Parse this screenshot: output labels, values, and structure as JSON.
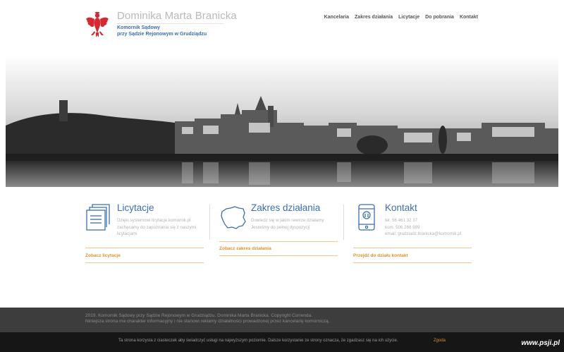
{
  "header": {
    "title": "Dominika Marta Branicka",
    "subtitle_line1": "Komornik Sądowy",
    "subtitle_line2": "przy Sądzie Rejonowym w Grudziądzu",
    "logo_icon": "eagle-icon",
    "nav": [
      {
        "label": "Kancelaria"
      },
      {
        "label": "Zakres działania"
      },
      {
        "label": "Licytacje"
      },
      {
        "label": "Do pobrania"
      },
      {
        "label": "Kontakt"
      }
    ]
  },
  "columns": [
    {
      "title": "Licytacje",
      "icon": "documents-icon",
      "text": [
        "Dzięki systemowi licytacje.komornik.pl",
        "zachęcamy do zapoznania się z naszymi",
        "licytacjami"
      ],
      "link": "Zobacz licytacje"
    },
    {
      "title": "Zakres działania",
      "icon": "poland-map-icon",
      "text": [
        "Dowiedz się w jakim rewirze działamy.",
        "Jesteśmy do pełnej dyspozycji"
      ],
      "link": "Zobacz zakres działania"
    },
    {
      "title": "Kontakt",
      "icon": "phone-icon",
      "text": [
        "tel. 56 461 32 37",
        "kom. 506 266 999",
        "email: grudziadz.branicka@komornik.pl"
      ],
      "link": "Przejdź do działu kontakt"
    }
  ],
  "footer": {
    "line1": "2019. Komornik Sądowy przy Sądzie Rejonowym w Grudziądzu. Dominika Marta Branicka. Copyright Currenda.",
    "line2": "Niniejsza strona ma charakter informacyjny i nie stanowi reklamy działalności prowadzonej przez kancelarię komorniczą."
  },
  "cookie": {
    "text": "Ta strona korzysta z ciasteczek aby świadczyć usługi na najwyższym poziomie. Dalsze korzystanie ze strony oznacza, że zgadzasz się na ich użycie.",
    "accept": "Zgoda"
  },
  "watermark": "www.psji.pl",
  "colors": {
    "accent_blue": "#3a6fb4",
    "accent_orange": "#d9922a",
    "footer_bg": "#3d3d3d",
    "cookie_bg": "#161616",
    "eagle_red": "#d7282f"
  }
}
